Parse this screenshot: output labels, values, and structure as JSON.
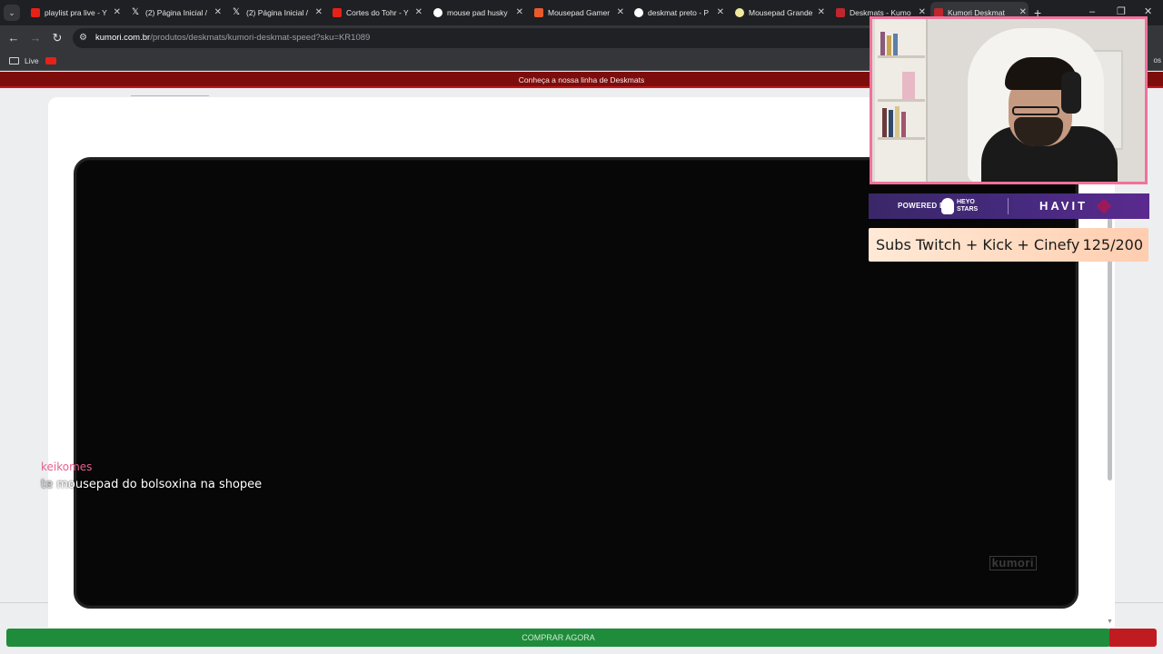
{
  "browser": {
    "tabs": [
      {
        "title": "playlist pra live - Y",
        "favicon": "youtube-icon",
        "color": "#e62117",
        "active": false
      },
      {
        "title": "(2) Página Inicial /",
        "favicon": "x-icon",
        "color": "#ffffff",
        "active": false
      },
      {
        "title": "(2) Página Inicial /",
        "favicon": "x-icon",
        "color": "#ffffff",
        "active": false
      },
      {
        "title": "Cortes do Tohr - Y",
        "favicon": "youtube-icon",
        "color": "#e62117",
        "active": false
      },
      {
        "title": "mouse pad husky",
        "favicon": "google-icon",
        "color": "#ffffff",
        "active": false
      },
      {
        "title": "Mousepad Gamer",
        "favicon": "shop-icon",
        "color": "#ea5a2a",
        "active": false
      },
      {
        "title": "deskmat preto - P",
        "favicon": "google-icon",
        "color": "#ffffff",
        "active": false
      },
      {
        "title": "Mousepad Grande",
        "favicon": "shop-icon",
        "color": "#f2e9a0",
        "active": false
      },
      {
        "title": "Deskmats - Kumo",
        "favicon": "kumori-icon",
        "color": "#c0262d",
        "active": false
      },
      {
        "title": "Kumori Deskmat",
        "favicon": "kumori-icon",
        "color": "#c0262d",
        "active": true
      }
    ],
    "url_host": "kumori.com.br",
    "url_path": "/produtos/deskmats/kumori-deskmat-speed?sku=KR1089",
    "bookmarks": {
      "folder_label": "Live",
      "all_label": "os"
    }
  },
  "page": {
    "promo_text": "Conheça a nossa linha de Deskmats",
    "mat_logo": "kumori",
    "buy_button": "COMPRAR AGORA"
  },
  "overlay": {
    "chat_user": "keikomes",
    "chat_prefix": "te",
    "chat_message": "mousepad do bolsoxina na shopee",
    "sponsor_powered": "POWERED BY",
    "sponsor_heyo_line1": "HEYO",
    "sponsor_heyo_line2": "STARS",
    "sponsor_havit": "HAVIT",
    "goal_label": "Subs Twitch + Kick + Cinefy",
    "goal_count": "125/200"
  },
  "colors": {
    "promo_bar": "#7d0d0d",
    "buy_button": "#1e8c3a",
    "webcam_border": "#f0729a",
    "sponsor_bg": "#462a7e",
    "chat_user": "#e8608c"
  }
}
